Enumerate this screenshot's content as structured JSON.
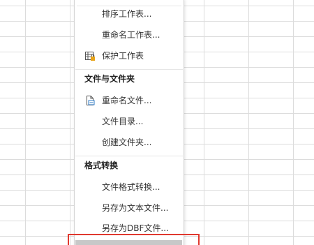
{
  "menu": {
    "items_top": [
      {
        "label": "排序工作表..."
      },
      {
        "label": "重命名工作表..."
      },
      {
        "label": "保护工作表",
        "icon": "protect-sheet-icon"
      }
    ],
    "section_files": {
      "title": "文件与文件夹",
      "items": [
        {
          "label": "重命名文件...",
          "icon": "rename-file-icon"
        },
        {
          "label": "文件目录..."
        },
        {
          "label": "创建文件夹..."
        }
      ]
    },
    "section_format": {
      "title": "格式转换",
      "items": [
        {
          "label": "文件格式转换..."
        },
        {
          "label": "另存为文本文件..."
        },
        {
          "label": "另存为DBF文件..."
        }
      ]
    }
  },
  "colors": {
    "highlight_border": "#e0392f",
    "grid_line": "#dcdcdc",
    "icon_accent": "#e8a317"
  }
}
